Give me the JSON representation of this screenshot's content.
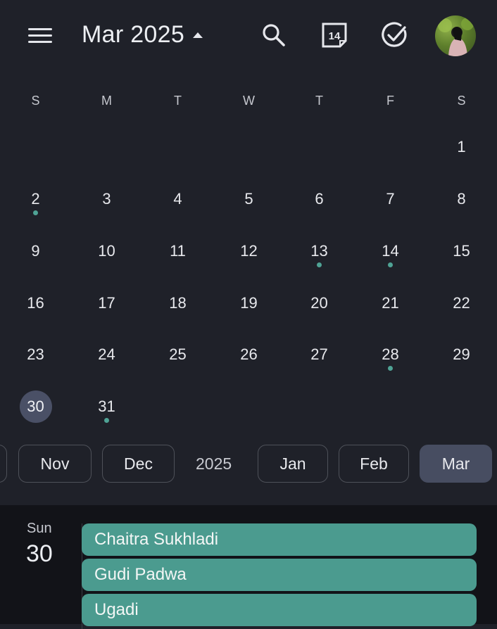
{
  "header": {
    "month_title": "Mar 2025",
    "today_date": "14",
    "icons": [
      "menu-icon",
      "search-icon",
      "today-calendar-icon",
      "tasks-check-icon",
      "avatar"
    ]
  },
  "weekdays": [
    "S",
    "M",
    "T",
    "W",
    "T",
    "F",
    "S"
  ],
  "days": [
    {
      "n": "1",
      "dot": false,
      "today": false
    },
    {
      "n": "2",
      "dot": true,
      "today": false
    },
    {
      "n": "3",
      "dot": false,
      "today": false
    },
    {
      "n": "4",
      "dot": false,
      "today": false
    },
    {
      "n": "5",
      "dot": false,
      "today": false
    },
    {
      "n": "6",
      "dot": false,
      "today": false
    },
    {
      "n": "7",
      "dot": false,
      "today": false
    },
    {
      "n": "8",
      "dot": false,
      "today": false
    },
    {
      "n": "9",
      "dot": false,
      "today": false
    },
    {
      "n": "10",
      "dot": false,
      "today": false
    },
    {
      "n": "11",
      "dot": false,
      "today": false
    },
    {
      "n": "12",
      "dot": false,
      "today": false
    },
    {
      "n": "13",
      "dot": true,
      "today": false
    },
    {
      "n": "14",
      "dot": true,
      "today": false
    },
    {
      "n": "15",
      "dot": false,
      "today": false
    },
    {
      "n": "16",
      "dot": false,
      "today": false
    },
    {
      "n": "17",
      "dot": false,
      "today": false
    },
    {
      "n": "18",
      "dot": false,
      "today": false
    },
    {
      "n": "19",
      "dot": false,
      "today": false
    },
    {
      "n": "20",
      "dot": false,
      "today": false
    },
    {
      "n": "21",
      "dot": false,
      "today": false
    },
    {
      "n": "22",
      "dot": false,
      "today": false
    },
    {
      "n": "23",
      "dot": false,
      "today": false
    },
    {
      "n": "24",
      "dot": false,
      "today": false
    },
    {
      "n": "25",
      "dot": false,
      "today": false
    },
    {
      "n": "26",
      "dot": false,
      "today": false
    },
    {
      "n": "27",
      "dot": false,
      "today": false
    },
    {
      "n": "28",
      "dot": true,
      "today": false
    },
    {
      "n": "29",
      "dot": false,
      "today": false
    },
    {
      "n": "30",
      "dot": false,
      "today": true
    },
    {
      "n": "31",
      "dot": true,
      "today": false
    }
  ],
  "month_strip": {
    "chips": [
      "Nov",
      "Dec"
    ],
    "year": "2025",
    "chips_after": [
      "Jan",
      "Feb",
      "Mar"
    ],
    "active": "Mar"
  },
  "schedule": {
    "day_name": "Sun",
    "day_num": "30",
    "events": [
      "Chaitra Sukhladi",
      "Gudi Padwa",
      "Ugadi"
    ],
    "event_color": "#4b9b8f"
  },
  "colors": {
    "background": "#1f2129",
    "accent_dot": "#4fa395",
    "today_highlight": "#4a5066",
    "active_chip": "#474d61"
  }
}
